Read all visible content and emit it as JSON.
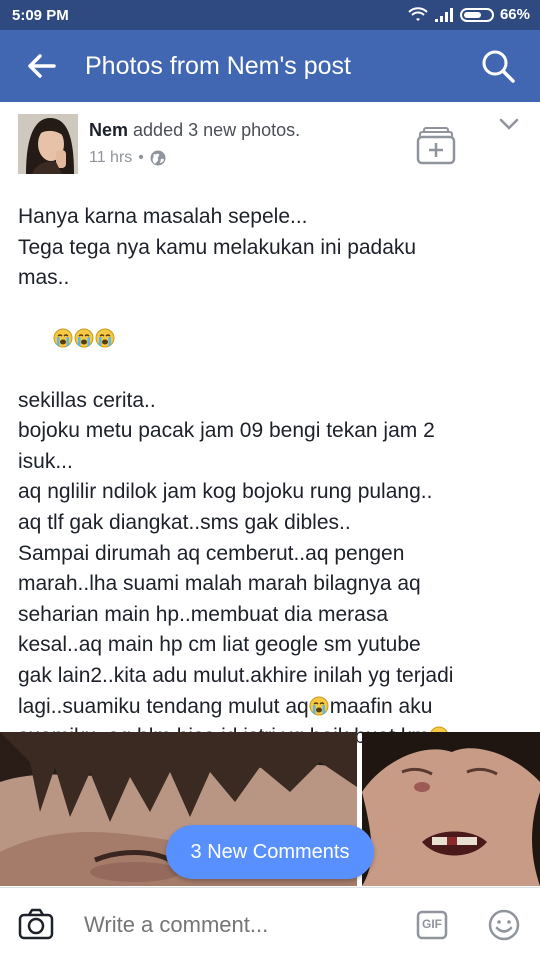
{
  "status_bar": {
    "time": "5:09 PM",
    "battery_percent": "66%",
    "battery_level": 0.66
  },
  "app_bar": {
    "title": "Photos from Nem's post",
    "back_icon": "arrow-left-icon",
    "search_icon": "search-icon"
  },
  "post": {
    "author": "Nem",
    "action": "added 3 new photos.",
    "timestamp": "11 hrs",
    "separator": "•",
    "privacy_icon": "globe-icon",
    "lines": [
      "Hanya karna masalah sepele...",
      "Tega tega nya kamu melakukan ini padaku",
      "mas..",
      "",
      "sekillas cerita..",
      "bojoku metu pacak jam 09 bengi tekan jam 2",
      "isuk...",
      "aq nglilir ndilok jam kog bojoku rung pulang..",
      "aq tlf gak diangkat..sms gak dibles..",
      "Sampai dirumah aq cemberut..aq pengen",
      "marah..lha suami malah marah bilagnya aq",
      "seharian main hp..membuat dia merasa",
      "kesal..aq main hp cm liat geogle sm yutube",
      "gak lain2..kita adu mulut.akhire inilah yg terjadi",
      "lagi..suamiku tendang mulut aq",
      "suamiku..aq blm bisa jd istri yg baik buat km",
      ""
    ],
    "line_after_emoji_13": "maafin aku",
    "new_comments_label": "3 New Comments"
  },
  "composer": {
    "placeholder": "Write a comment...",
    "camera_icon": "camera-icon",
    "gif_label": "GIF",
    "smiley_icon": "smiley-icon"
  },
  "colors": {
    "status_bar": "#2f4a80",
    "app_bar": "#4267b2",
    "pill": "#5890ff",
    "text": "#1d2129",
    "muted": "#90949c"
  }
}
